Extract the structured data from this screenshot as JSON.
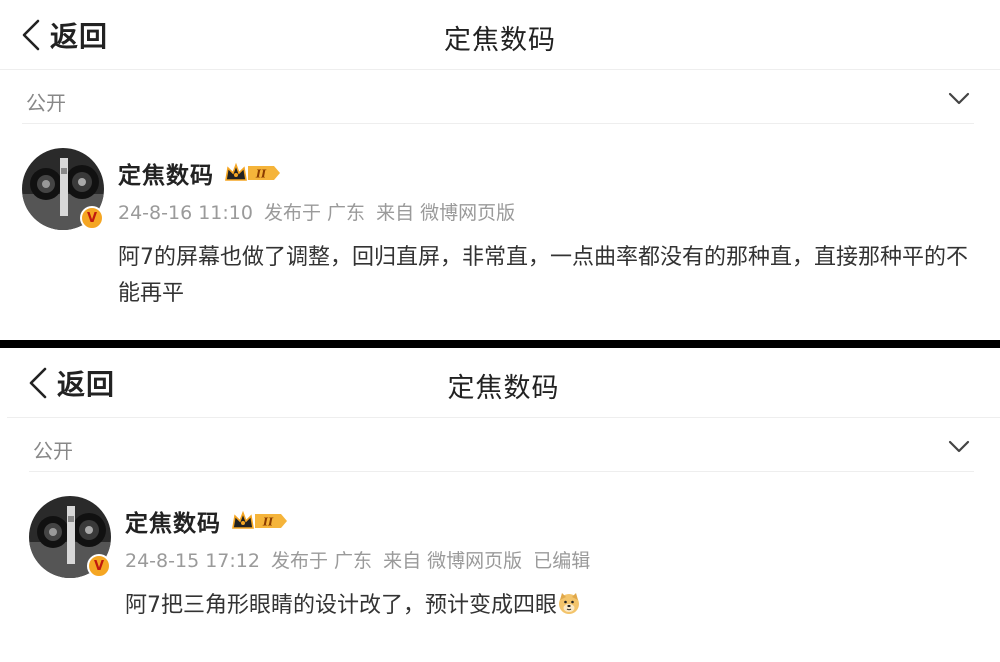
{
  "colors": {
    "separator": "#000000",
    "badge_gold": "#f5a623",
    "badge_red": "#c0190f",
    "meta_gray": "#9a9a9a"
  },
  "panels": [
    {
      "nav": {
        "back_icon": "chevron-left-icon",
        "back_label": "返回",
        "title": "定焦数码"
      },
      "visibility": {
        "label": "公开",
        "icon": "chevron-down-icon"
      },
      "post": {
        "username": "定焦数码",
        "badge_level": "II",
        "verified_mark": "V",
        "timestamp": "24-8-16 11:10",
        "location": "发布于 广东",
        "source": "来自 微博网页版",
        "edited": "",
        "text": "阿7的屏幕也做了调整，回归直屏，非常直，一点曲率都没有的那种直，直接那种平的不能再平"
      }
    },
    {
      "nav": {
        "back_icon": "chevron-left-icon",
        "back_label": "返回",
        "title": "定焦数码"
      },
      "visibility": {
        "label": "公开",
        "icon": "chevron-down-icon"
      },
      "post": {
        "username": "定焦数码",
        "badge_level": "II",
        "verified_mark": "V",
        "timestamp": "24-8-15 17:12",
        "location": "发布于 广东",
        "source": "来自 微博网页版",
        "edited": "已编辑",
        "text": "阿7把三角形眼睛的设计改了，预计变成四眼",
        "trailing_emoji": "doge-emoji"
      }
    }
  ]
}
